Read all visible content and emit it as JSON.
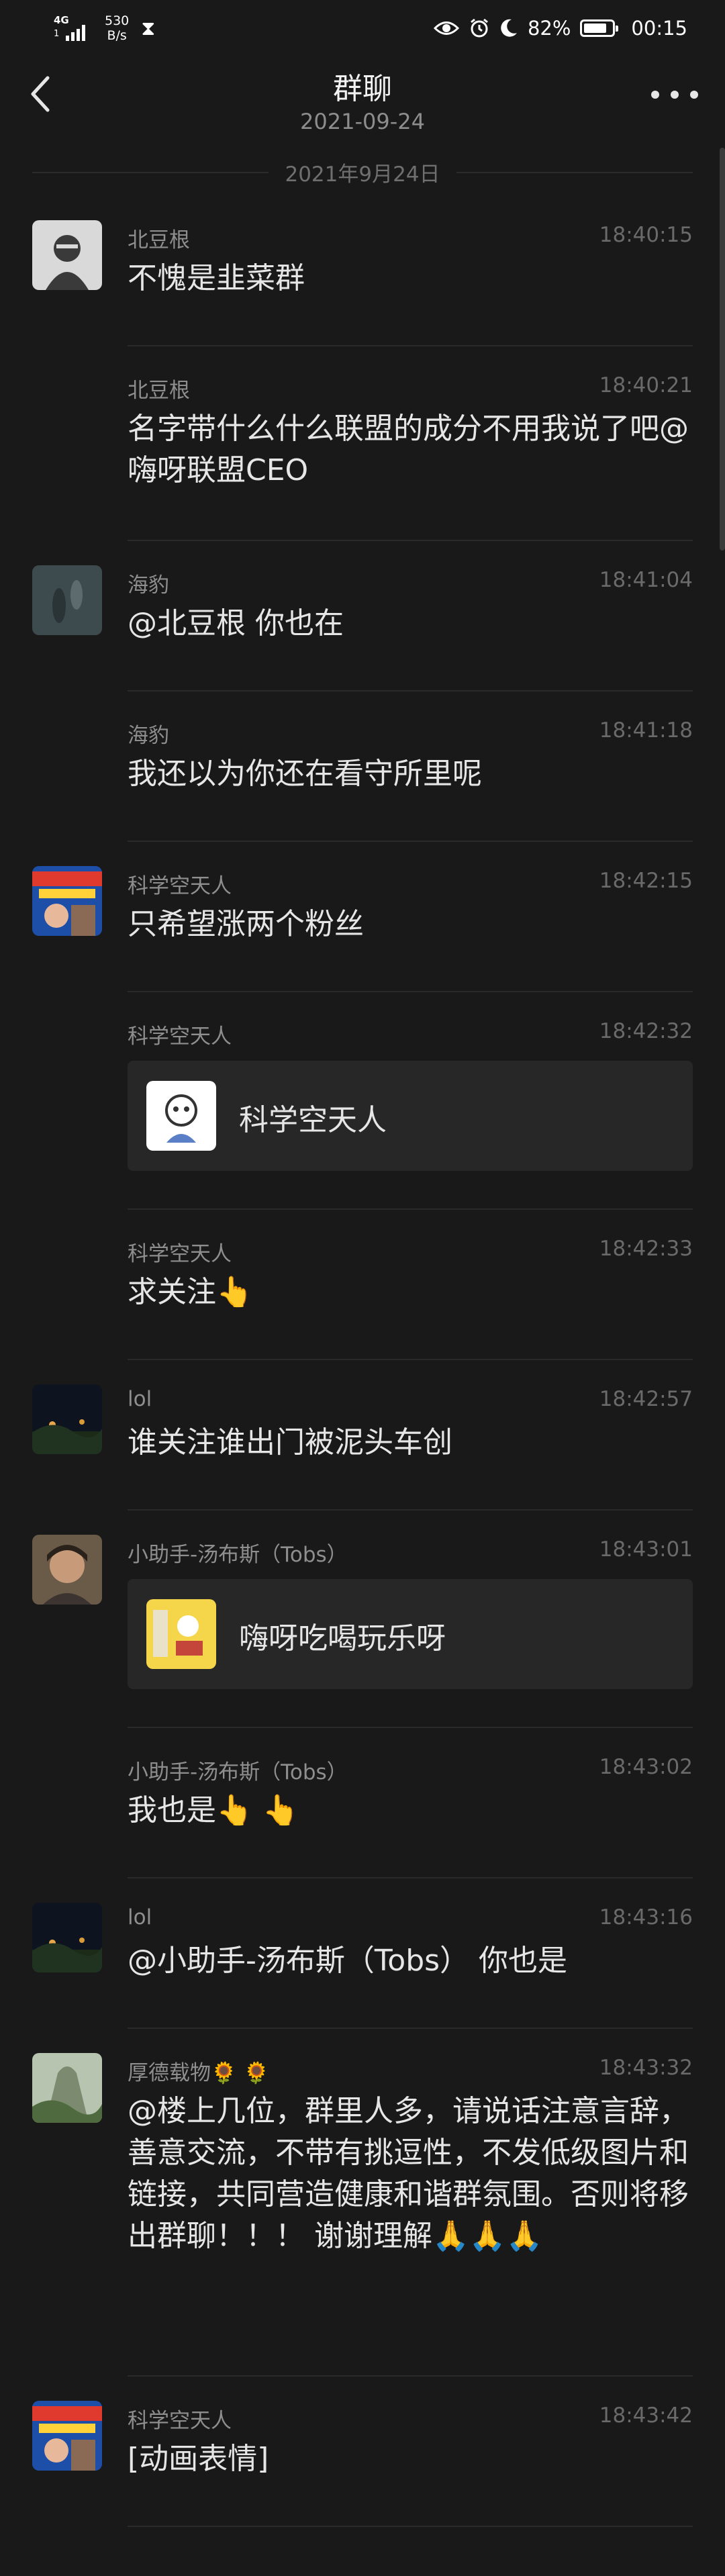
{
  "status_bar": {
    "network": "4G",
    "network_sub": "1",
    "speed_value": "530",
    "speed_unit": "B/s",
    "battery": "82%",
    "battery_level": 0.82,
    "time": "00:15"
  },
  "header": {
    "title": "群聊",
    "subtitle": "2021-09-24"
  },
  "date_separator": "2021年9月24日",
  "messages": [
    {
      "sender": "北豆根",
      "time": "18:40:15",
      "text": "不愧是韭菜群"
    },
    {
      "sender": "北豆根",
      "time": "18:40:21",
      "text": "名字带什么什么联盟的成分不用我说了吧@嗨呀联盟CEO"
    },
    {
      "sender": "海豹",
      "time": "18:41:04",
      "text": "@北豆根 你也在"
    },
    {
      "sender": "海豹",
      "time": "18:41:18",
      "text": "我还以为你还在看守所里呢"
    },
    {
      "sender": "科学空天人",
      "time": "18:42:15",
      "text": "只希望涨两个粉丝"
    },
    {
      "sender": "科学空天人",
      "time": "18:42:32",
      "card_label": "科学空天人"
    },
    {
      "sender": "科学空天人",
      "time": "18:42:33",
      "text": "求关注",
      "emoji": "👆"
    },
    {
      "sender": "lol",
      "time": "18:42:57",
      "text": "谁关注谁出门被泥头车创"
    },
    {
      "sender": "小助手-汤布斯（Tobs）",
      "time": "18:43:01",
      "card_label": "嗨呀吃喝玩乐呀"
    },
    {
      "sender": "小助手-汤布斯（Tobs）",
      "time": "18:43:02",
      "text": "我也是",
      "emoji": "👆 👆"
    },
    {
      "sender": "lol",
      "time": "18:43:16",
      "text": "@小助手-汤布斯（Tobs） 你也是"
    },
    {
      "sender": "厚德载物",
      "sender_emoji": "🌻 🌻",
      "time": "18:43:32",
      "text": "@楼上几位，群里人多，请说话注意言辞，善意交流，不带有挑逗性，不发低级图片和链接，共同营造健康和谐群氛围。否则将移出群聊！！！ 谢谢理解",
      "emoji": "🙏🙏🙏"
    },
    {
      "sender": "科学空天人",
      "time": "18:43:42",
      "text": "[动画表情]"
    }
  ],
  "colors": {
    "background": "#191919",
    "text": "#e6e6e6",
    "meta": "#8e8e8e",
    "card": "#272727"
  }
}
